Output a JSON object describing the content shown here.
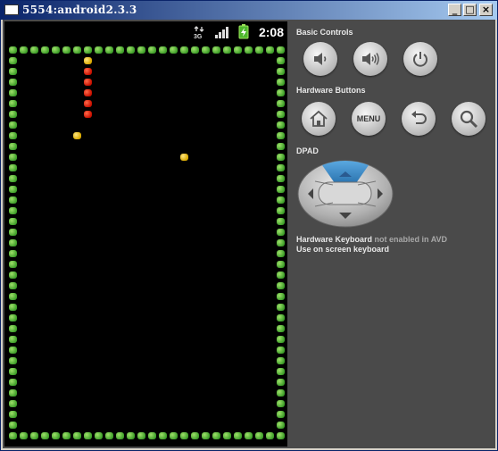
{
  "window": {
    "title": "5554:android2.3.3",
    "minimize_glyph": "_",
    "maximize_glyph": "□",
    "close_glyph": "×"
  },
  "statusbar": {
    "clock": "2:08",
    "network_label": "3G",
    "icons": [
      "data-network-icon",
      "signal-icon",
      "battery-charging-icon"
    ]
  },
  "game": {
    "name": "snake",
    "grid": {
      "cols": 26,
      "rows": 37
    },
    "snake": [
      {
        "col": 7,
        "row": 1,
        "part": "head"
      },
      {
        "col": 7,
        "row": 2
      },
      {
        "col": 7,
        "row": 3
      },
      {
        "col": 7,
        "row": 4
      },
      {
        "col": 7,
        "row": 5
      },
      {
        "col": 7,
        "row": 6
      }
    ],
    "apples": [
      {
        "col": 6,
        "row": 8
      },
      {
        "col": 16,
        "row": 10
      }
    ]
  },
  "panel": {
    "basic_controls_label": "Basic Controls",
    "basic_controls": [
      {
        "name": "volume-down",
        "icon": "volume-down-icon"
      },
      {
        "name": "volume-up",
        "icon": "volume-up-icon"
      },
      {
        "name": "power",
        "icon": "power-icon"
      }
    ],
    "hardware_buttons_label": "Hardware Buttons",
    "hardware_buttons": [
      {
        "name": "home",
        "icon": "home-icon"
      },
      {
        "name": "menu",
        "label": "MENU"
      },
      {
        "name": "back",
        "icon": "back-icon"
      },
      {
        "name": "search",
        "icon": "search-icon"
      }
    ],
    "dpad_label": "DPAD",
    "dpad_highlighted": "up",
    "keyboard_hint_bold": "Hardware Keyboard",
    "keyboard_hint_muted": "not enabled in AVD",
    "keyboard_hint_line2": "Use on screen keyboard"
  },
  "colors": {
    "wall": "#5cc83a",
    "snake_body": "#e02000",
    "snake_head": "#f4c820",
    "apple": "#f4c820",
    "dpad_highlight": "#3c8cc8",
    "panel_bg": "#4a4a4a"
  }
}
